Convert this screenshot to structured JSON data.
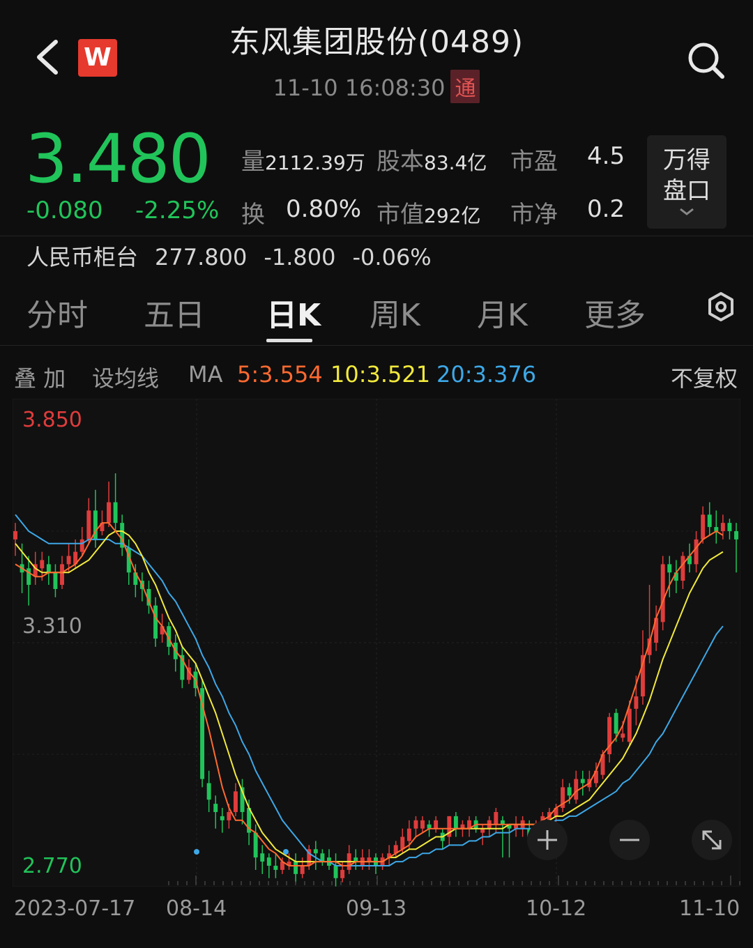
{
  "header": {
    "title": "东风集团股份(0489)",
    "time": "11-10 16:08:30",
    "connect_badge": "通",
    "logo_letter": "W"
  },
  "quote": {
    "price": "3.480",
    "change": "-0.080",
    "change_pct": "-2.25%",
    "stats": [
      {
        "label": "量",
        "value": "2112.39万"
      },
      {
        "label": "股本",
        "value": "83.4亿"
      },
      {
        "label": "市盈",
        "value": "4.5"
      },
      {
        "label": "换",
        "value": "0.80%"
      },
      {
        "label": "市值",
        "value": "292亿"
      },
      {
        "label": "市净",
        "value": "0.2"
      }
    ],
    "wind_button": "万得盘口",
    "wind_line1": "万得",
    "wind_line2": "盘口"
  },
  "rmb_counter": {
    "label": "人民币柜台",
    "price": "277.800",
    "change": "-1.800",
    "change_pct": "-0.06%"
  },
  "tabs": [
    "分时",
    "五日",
    "日K",
    "周K",
    "月K",
    "更多"
  ],
  "active_tab": "日K",
  "ma_bar": {
    "overlay": "叠 加",
    "set_ma": "设均线",
    "ma": "MA",
    "ma5": "5:3.554",
    "ma10": "10:3.521",
    "ma20": "20:3.376",
    "adjust": "不复权",
    "colors": {
      "ma5": "#ff6a30",
      "ma10": "#f2ea3c",
      "ma20": "#3da8e8"
    }
  },
  "colors": {
    "up": "#e03c3c",
    "down": "#21c45a",
    "bg": "#0e0e0e"
  },
  "chart_data": {
    "type": "candlestick",
    "y_labels": [
      "3.850",
      "3.310",
      "2.770"
    ],
    "ylim": [
      2.77,
      3.85
    ],
    "x_labels": [
      "2023-07-17",
      "08-14",
      "09-13",
      "10-12",
      "11-10"
    ],
    "candles": [
      [
        3.56,
        3.58,
        3.52,
        3.6
      ],
      [
        3.5,
        3.48,
        3.43,
        3.55
      ],
      [
        3.49,
        3.45,
        3.4,
        3.52
      ],
      [
        3.47,
        3.5,
        3.45,
        3.53
      ],
      [
        3.49,
        3.51,
        3.46,
        3.53
      ],
      [
        3.5,
        3.48,
        3.45,
        3.52
      ],
      [
        3.48,
        3.44,
        3.42,
        3.5
      ],
      [
        3.45,
        3.5,
        3.44,
        3.52
      ],
      [
        3.5,
        3.52,
        3.48,
        3.55
      ],
      [
        3.5,
        3.53,
        3.49,
        3.56
      ],
      [
        3.53,
        3.56,
        3.52,
        3.59
      ],
      [
        3.56,
        3.63,
        3.55,
        3.66
      ],
      [
        3.63,
        3.56,
        3.54,
        3.68
      ],
      [
        3.58,
        3.6,
        3.57,
        3.63
      ],
      [
        3.6,
        3.65,
        3.59,
        3.7
      ],
      [
        3.65,
        3.6,
        3.58,
        3.72
      ],
      [
        3.6,
        3.54,
        3.52,
        3.62
      ],
      [
        3.54,
        3.48,
        3.45,
        3.56
      ],
      [
        3.48,
        3.45,
        3.42,
        3.5
      ],
      [
        3.46,
        3.44,
        3.41,
        3.48
      ],
      [
        3.44,
        3.4,
        3.38,
        3.46
      ],
      [
        3.4,
        3.32,
        3.3,
        3.42
      ],
      [
        3.33,
        3.35,
        3.31,
        3.38
      ],
      [
        3.35,
        3.3,
        3.28,
        3.36
      ],
      [
        3.31,
        3.27,
        3.24,
        3.33
      ],
      [
        3.28,
        3.22,
        3.2,
        3.3
      ],
      [
        3.22,
        3.25,
        3.21,
        3.27
      ],
      [
        3.24,
        3.2,
        3.18,
        3.26
      ],
      [
        3.2,
        2.98,
        2.96,
        3.22
      ],
      [
        2.97,
        2.93,
        2.9,
        3.0
      ],
      [
        2.92,
        2.9,
        2.86,
        2.94
      ],
      [
        2.89,
        2.88,
        2.85,
        2.91
      ],
      [
        2.88,
        2.9,
        2.86,
        2.92
      ],
      [
        2.9,
        2.95,
        2.89,
        2.97
      ],
      [
        2.96,
        2.9,
        2.87,
        2.98
      ],
      [
        2.91,
        2.85,
        2.82,
        2.93
      ],
      [
        2.85,
        2.79,
        2.76,
        2.87
      ],
      [
        2.8,
        2.78,
        2.75,
        2.82
      ],
      [
        2.79,
        2.77,
        2.74,
        2.8
      ],
      [
        2.77,
        2.76,
        2.74,
        2.8
      ],
      [
        2.76,
        2.78,
        2.75,
        2.79
      ],
      [
        2.77,
        2.78,
        2.76,
        2.8
      ],
      [
        2.78,
        2.75,
        2.73,
        2.8
      ],
      [
        2.75,
        2.77,
        2.74,
        2.79
      ],
      [
        2.77,
        2.81,
        2.76,
        2.82
      ],
      [
        2.81,
        2.8,
        2.76,
        2.83
      ],
      [
        2.8,
        2.78,
        2.77,
        2.81
      ],
      [
        2.79,
        2.77,
        2.76,
        2.81
      ],
      [
        2.77,
        2.74,
        2.72,
        2.8
      ],
      [
        2.74,
        2.76,
        2.73,
        2.78
      ],
      [
        2.76,
        2.8,
        2.75,
        2.82
      ],
      [
        2.79,
        2.78,
        2.76,
        2.81
      ],
      [
        2.77,
        2.79,
        2.76,
        2.81
      ],
      [
        2.78,
        2.79,
        2.76,
        2.81
      ],
      [
        2.79,
        2.77,
        2.75,
        2.8
      ],
      [
        2.77,
        2.79,
        2.76,
        2.8
      ],
      [
        2.79,
        2.8,
        2.77,
        2.82
      ],
      [
        2.8,
        2.82,
        2.79,
        2.83
      ],
      [
        2.81,
        2.84,
        2.8,
        2.86
      ],
      [
        2.83,
        2.86,
        2.81,
        2.88
      ],
      [
        2.86,
        2.88,
        2.84,
        2.89
      ],
      [
        2.86,
        2.88,
        2.85,
        2.89
      ],
      [
        2.87,
        2.86,
        2.84,
        2.88
      ],
      [
        2.86,
        2.88,
        2.85,
        2.89
      ],
      [
        2.85,
        2.83,
        2.81,
        2.86
      ],
      [
        2.84,
        2.89,
        2.82,
        2.89
      ],
      [
        2.89,
        2.86,
        2.84,
        2.9
      ],
      [
        2.86,
        2.87,
        2.84,
        2.88
      ],
      [
        2.86,
        2.88,
        2.84,
        2.89
      ],
      [
        2.88,
        2.86,
        2.85,
        2.89
      ],
      [
        2.85,
        2.86,
        2.82,
        2.87
      ],
      [
        2.86,
        2.88,
        2.84,
        2.89
      ],
      [
        2.87,
        2.9,
        2.85,
        2.91
      ],
      [
        2.88,
        2.87,
        2.79,
        2.89
      ],
      [
        2.87,
        2.86,
        2.79,
        2.87
      ],
      [
        2.86,
        2.87,
        2.84,
        2.89
      ],
      [
        2.86,
        2.88,
        2.84,
        2.89
      ],
      [
        2.86,
        2.84,
        2.83,
        2.88
      ],
      [
        2.85,
        2.87,
        2.84,
        2.88
      ],
      [
        2.86,
        2.89,
        2.84,
        2.9
      ],
      [
        2.88,
        2.9,
        2.85,
        2.91
      ],
      [
        2.89,
        2.91,
        2.86,
        2.92
      ],
      [
        2.91,
        2.96,
        2.9,
        2.98
      ],
      [
        2.96,
        2.94,
        2.92,
        2.97
      ],
      [
        2.93,
        2.98,
        2.92,
        3.0
      ],
      [
        2.98,
        2.97,
        2.94,
        3.0
      ],
      [
        2.96,
        2.98,
        2.95,
        3.0
      ],
      [
        2.97,
        3.0,
        2.96,
        3.02
      ],
      [
        2.99,
        3.04,
        2.98,
        3.05
      ],
      [
        3.04,
        3.13,
        3.02,
        3.14
      ],
      [
        3.14,
        3.09,
        3.07,
        3.15
      ],
      [
        3.08,
        3.09,
        3.07,
        3.12
      ],
      [
        3.07,
        3.15,
        3.06,
        3.17
      ],
      [
        3.15,
        3.18,
        3.11,
        3.23
      ],
      [
        3.18,
        3.28,
        3.16,
        3.34
      ],
      [
        3.28,
        3.32,
        3.26,
        3.45
      ],
      [
        3.31,
        3.37,
        3.29,
        3.4
      ],
      [
        3.36,
        3.5,
        3.34,
        3.52
      ],
      [
        3.5,
        3.48,
        3.42,
        3.52
      ],
      [
        3.48,
        3.46,
        3.43,
        3.51
      ],
      [
        3.46,
        3.52,
        3.44,
        3.53
      ],
      [
        3.52,
        3.5,
        3.48,
        3.55
      ],
      [
        3.5,
        3.56,
        3.48,
        3.58
      ],
      [
        3.56,
        3.62,
        3.55,
        3.64
      ],
      [
        3.62,
        3.59,
        3.57,
        3.65
      ],
      [
        3.59,
        3.58,
        3.55,
        3.63
      ],
      [
        3.58,
        3.6,
        3.56,
        3.62
      ],
      [
        3.6,
        3.58,
        3.56,
        3.61
      ],
      [
        3.58,
        3.56,
        3.48,
        3.6
      ]
    ],
    "ma5": [
      3.5,
      3.49,
      3.48,
      3.47,
      3.47,
      3.48,
      3.48,
      3.48,
      3.49,
      3.5,
      3.52,
      3.55,
      3.58,
      3.6,
      3.6,
      3.58,
      3.56,
      3.52,
      3.48,
      3.45,
      3.41,
      3.37,
      3.35,
      3.32,
      3.29,
      3.27,
      3.24,
      3.22,
      3.16,
      3.1,
      3.03,
      2.96,
      2.91,
      2.88,
      2.88,
      2.86,
      2.85,
      2.83,
      2.81,
      2.8,
      2.78,
      2.77,
      2.77,
      2.77,
      2.77,
      2.78,
      2.78,
      2.78,
      2.78,
      2.77,
      2.77,
      2.78,
      2.78,
      2.78,
      2.78,
      2.78,
      2.79,
      2.8,
      2.81,
      2.82,
      2.84,
      2.85,
      2.86,
      2.86,
      2.86,
      2.86,
      2.86,
      2.86,
      2.86,
      2.87,
      2.87,
      2.87,
      2.87,
      2.87,
      2.87,
      2.87,
      2.87,
      2.87,
      2.87,
      2.88,
      2.89,
      2.91,
      2.92,
      2.93,
      2.95,
      2.96,
      2.97,
      3.0,
      3.04,
      3.06,
      3.08,
      3.11,
      3.16,
      3.21,
      3.26,
      3.31,
      3.37,
      3.41,
      3.45,
      3.48,
      3.5,
      3.52,
      3.54,
      3.56,
      3.57,
      3.58,
      3.57
    ],
    "ma10": [
      3.55,
      3.53,
      3.51,
      3.49,
      3.48,
      3.48,
      3.48,
      3.48,
      3.48,
      3.49,
      3.5,
      3.51,
      3.53,
      3.55,
      3.57,
      3.58,
      3.58,
      3.57,
      3.55,
      3.52,
      3.48,
      3.45,
      3.41,
      3.37,
      3.34,
      3.3,
      3.28,
      3.26,
      3.22,
      3.18,
      3.14,
      3.09,
      3.04,
      2.99,
      2.95,
      2.91,
      2.88,
      2.85,
      2.83,
      2.81,
      2.8,
      2.79,
      2.78,
      2.78,
      2.78,
      2.78,
      2.78,
      2.78,
      2.78,
      2.78,
      2.78,
      2.78,
      2.78,
      2.78,
      2.78,
      2.78,
      2.79,
      2.79,
      2.8,
      2.81,
      2.81,
      2.82,
      2.83,
      2.84,
      2.84,
      2.85,
      2.86,
      2.86,
      2.86,
      2.86,
      2.86,
      2.86,
      2.86,
      2.86,
      2.87,
      2.87,
      2.87,
      2.87,
      2.87,
      2.87,
      2.88,
      2.89,
      2.89,
      2.9,
      2.91,
      2.92,
      2.93,
      2.95,
      2.97,
      2.99,
      3.01,
      3.03,
      3.06,
      3.09,
      3.13,
      3.17,
      3.22,
      3.27,
      3.31,
      3.35,
      3.39,
      3.43,
      3.46,
      3.49,
      3.51,
      3.52,
      3.53
    ],
    "ma20": [
      3.62,
      3.6,
      3.58,
      3.57,
      3.56,
      3.55,
      3.55,
      3.55,
      3.55,
      3.55,
      3.55,
      3.56,
      3.56,
      3.56,
      3.56,
      3.55,
      3.55,
      3.54,
      3.53,
      3.52,
      3.5,
      3.48,
      3.46,
      3.43,
      3.41,
      3.38,
      3.35,
      3.32,
      3.28,
      3.25,
      3.21,
      3.18,
      3.14,
      3.11,
      3.07,
      3.04,
      3.0,
      2.97,
      2.94,
      2.91,
      2.88,
      2.86,
      2.84,
      2.82,
      2.8,
      2.79,
      2.78,
      2.78,
      2.77,
      2.77,
      2.77,
      2.77,
      2.77,
      2.77,
      2.77,
      2.77,
      2.77,
      2.78,
      2.78,
      2.79,
      2.79,
      2.8,
      2.8,
      2.81,
      2.81,
      2.82,
      2.82,
      2.82,
      2.83,
      2.83,
      2.84,
      2.84,
      2.85,
      2.85,
      2.85,
      2.86,
      2.86,
      2.86,
      2.86,
      2.87,
      2.87,
      2.88,
      2.88,
      2.89,
      2.89,
      2.9,
      2.91,
      2.92,
      2.93,
      2.94,
      2.95,
      2.97,
      2.98,
      3.0,
      3.02,
      3.04,
      3.07,
      3.09,
      3.12,
      3.15,
      3.18,
      3.21,
      3.24,
      3.27,
      3.3,
      3.33,
      3.35
    ]
  }
}
